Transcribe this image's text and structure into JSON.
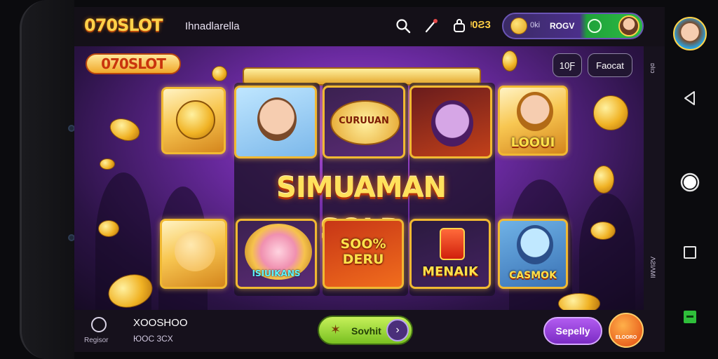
{
  "topbar": {
    "logo": "070SLOT",
    "title": "Ihnadlarella",
    "coins_text": "ᵎ0Ƨ3",
    "wallet": {
      "label": "0ki",
      "value": "ROGV"
    }
  },
  "game": {
    "logo": "070SLOT",
    "pill_left": "10Ƒ",
    "pill_right": "Faocat",
    "banner": "SIMUAMAN SOLD",
    "symbols": {
      "r1": "CURUUAN",
      "r2": "LOOUI",
      "r3": "ISIUIKANS",
      "r4": "SOO% DERU",
      "r5": "MENAIK",
      "r6": "CASMOK"
    },
    "side_text_top": "ᴅΙıɔ",
    "side_text_bottom": "ɅƧIɅΜI"
  },
  "bottombar": {
    "icon_label": "Regisor",
    "value1": "XOOSHOO",
    "value2": "ЮOC 3CX",
    "spin_label": "Sovhit",
    "primary_label": "Sepelly",
    "promo_label": "ELOORO"
  },
  "colors": {
    "accent_gold": "#ffd24a",
    "stage_purple": "#6a2aa0",
    "spin_green": "#79c021",
    "primary_purple": "#7b2cc4"
  }
}
